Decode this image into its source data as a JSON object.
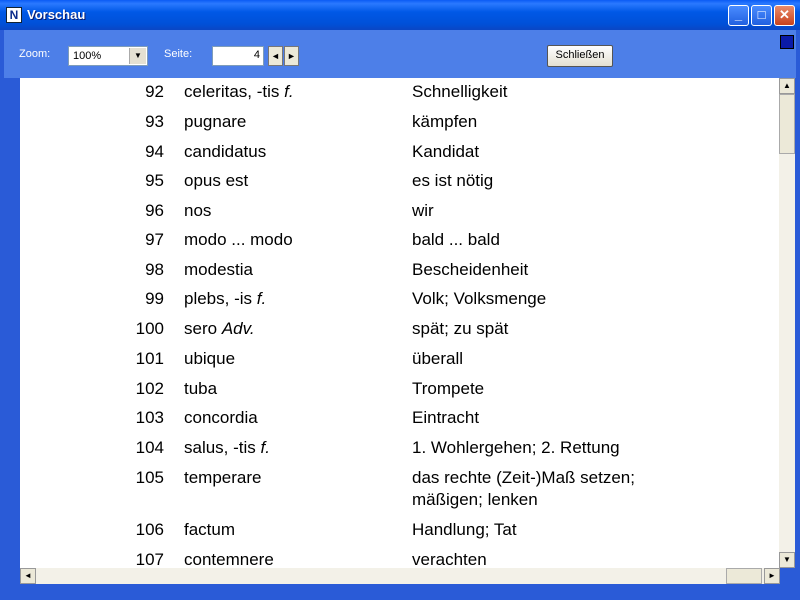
{
  "window": {
    "title": "Vorschau",
    "icon": "app-icon",
    "icon_letter": "N"
  },
  "captions": {
    "minimize": "_",
    "maximize": "□",
    "close": "✕"
  },
  "toolbar": {
    "zoom_label": "Zoom:",
    "zoom_value": "100%",
    "page_label": "Seite:",
    "page_value": "4",
    "close_label": "Schließen"
  },
  "rows": [
    {
      "num": "92",
      "latin": "celeritas, -tis",
      "latin_italic": "f.",
      "german": "Schnelligkeit"
    },
    {
      "num": "93",
      "latin": "pugnare",
      "latin_italic": "",
      "german": "kämpfen"
    },
    {
      "num": "94",
      "latin": "candidatus",
      "latin_italic": "",
      "german": "Kandidat"
    },
    {
      "num": "95",
      "latin": "opus est",
      "latin_italic": "",
      "german": "es ist nötig"
    },
    {
      "num": "96",
      "latin": "nos",
      "latin_italic": "",
      "german": "wir"
    },
    {
      "num": "97",
      "latin": "modo ... modo",
      "latin_italic": "",
      "german": "bald ... bald"
    },
    {
      "num": "98",
      "latin": "modestia",
      "latin_italic": "",
      "german": "Bescheidenheit"
    },
    {
      "num": "99",
      "latin": "plebs, -is",
      "latin_italic": "f.",
      "german": "Volk; Volksmenge"
    },
    {
      "num": "100",
      "latin": "sero",
      "latin_italic": "Adv.",
      "german": "spät; zu spät"
    },
    {
      "num": "101",
      "latin": "ubique",
      "latin_italic": "",
      "german": "überall"
    },
    {
      "num": "102",
      "latin": "tuba",
      "latin_italic": "",
      "german": "Trompete"
    },
    {
      "num": "103",
      "latin": "concordia",
      "latin_italic": "",
      "german": "Eintracht"
    },
    {
      "num": "104",
      "latin": "salus, -tis",
      "latin_italic": "f.",
      "german": "1. Wohlergehen; 2. Rettung"
    },
    {
      "num": "105",
      "latin": "temperare",
      "latin_italic": "",
      "german": "das rechte (Zeit-)Maß setzen;",
      "german2": "mäßigen; lenken"
    },
    {
      "num": "106",
      "latin": "factum",
      "latin_italic": "",
      "german": "Handlung; Tat"
    },
    {
      "num": "107",
      "latin": "contemnere",
      "latin_italic": "",
      "german": "verachten"
    }
  ],
  "scrollbar": {
    "up": "▲",
    "down": "▼",
    "left": "◄",
    "right": "►"
  },
  "colors": {
    "titlebar": "#0054e3",
    "toolbar": "#4d7fe8",
    "frame": "#2a5bd7"
  }
}
